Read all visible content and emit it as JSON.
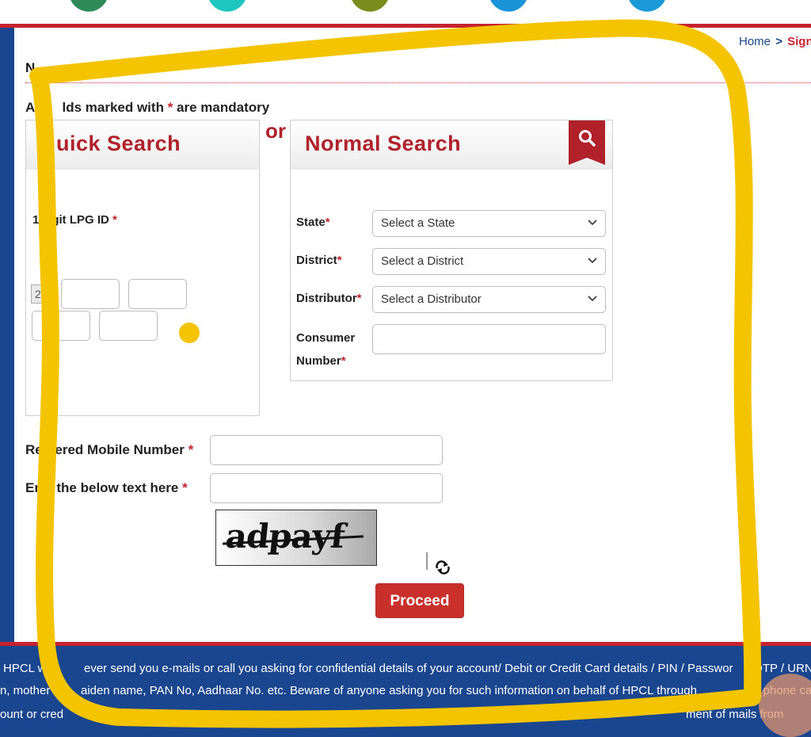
{
  "breadcrumb": {
    "home": "Home",
    "separator": ">",
    "current": "SignU"
  },
  "page": {
    "title": "N"
  },
  "mandatory_note": {
    "before": "All",
    "middle": "lds marked with",
    "star": "*",
    "after": "are mandatory"
  },
  "quick_search": {
    "title": "uick Search",
    "lpg_label": "1",
    "lpg_label_rest": "git LPG ID",
    "required": "*",
    "lpg_prefix": "2"
  },
  "or_label": "or",
  "normal_search": {
    "title": "Normal Search",
    "state": {
      "label": "State",
      "required": "*",
      "placeholder": "Select a State"
    },
    "district": {
      "label": "District",
      "required": "*",
      "placeholder": "Select a District"
    },
    "distributor": {
      "label": "Distributor",
      "required": "*",
      "placeholder": "Select a Distributor"
    },
    "consumer": {
      "label_line1": "Consumer",
      "label_line2": "Number",
      "required": "*"
    }
  },
  "mobile": {
    "label_a": "Re",
    "label_b": "tered Mobile Number",
    "required": "*"
  },
  "captcha_field": {
    "label_a": "Ent",
    "label_b": "the below text here",
    "required": "*"
  },
  "captcha": {
    "text": "adpayf"
  },
  "proceed_label": "Proceed",
  "footer": {
    "line1a": "HPCL w",
    "line1b": "ever send you e-mails or call you asking for confidential details of your account/ Debit or Credit Card details / PIN / Passwor",
    "line1c": "DTP / URN",
    "line2a": "n, mother",
    "line2b": "aiden name, PAN No, Aadhaar No. etc. Beware of anyone asking you for such information on behalf of HPCL through",
    "line2c": "or phone ca",
    "line3a": "ount or cred",
    "line3b": "ment of mails from"
  },
  "colors": {
    "brand_red": "#c7232e",
    "brand_blue": "#1a4690",
    "highlight": "#f5c400"
  }
}
